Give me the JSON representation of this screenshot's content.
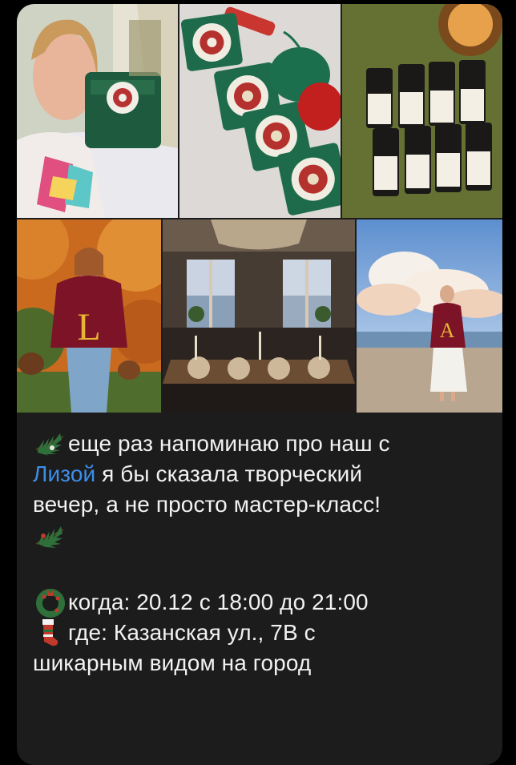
{
  "message": {
    "line1": "еще раз напоминаю про наш с",
    "mention": "Лизой",
    "line2_rest": " я бы сказала творческий",
    "line3": "вечер, а не просто мастер-класс!",
    "line4_when": "когда: 20.12 с 18:00 до 21:00",
    "line5_where": "где: Казанская ул., 7В с",
    "line6": "шикарным видом на город"
  },
  "photos": [
    {
      "name": "photo-woman-crochet-squares"
    },
    {
      "name": "photo-granny-squares-yarn"
    },
    {
      "name": "photo-essential-oil-bottles"
    },
    {
      "name": "photo-woman-autumn-sweater-l"
    },
    {
      "name": "photo-dining-room-event"
    },
    {
      "name": "photo-woman-beach-sweater-a"
    }
  ],
  "emoji": [
    "fir-branch-icon",
    "fir-branch-icon",
    "wreath-icon",
    "stocking-icon"
  ],
  "colors": {
    "mention": "#3e8eea",
    "bubble": "#1c1c1d",
    "text": "#f2f2f2"
  }
}
